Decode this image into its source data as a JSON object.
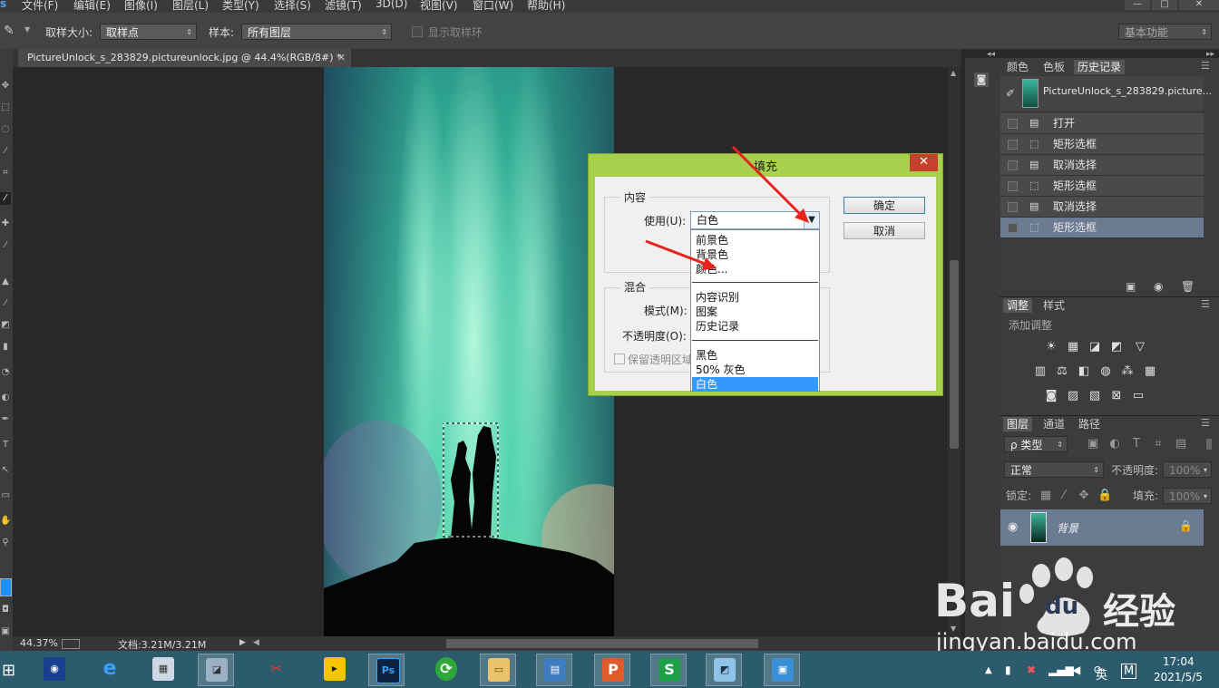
{
  "menubar": {
    "items": [
      "文件(F)",
      "编辑(E)",
      "图像(I)",
      "图层(L)",
      "类型(Y)",
      "选择(S)",
      "滤镜(T)",
      "3D(D)",
      "视图(V)",
      "窗口(W)",
      "帮助(H)"
    ]
  },
  "options": {
    "sample_size_label": "取样大小:",
    "sample_size_value": "取样点",
    "sample_label": "样本:",
    "sample_value": "所有图层",
    "show_ring_label": "显示取样环",
    "workspace": "基本功能"
  },
  "document": {
    "tab_title": "PictureUnlock_s_283829.pictureunlock.jpg @ 44.4%(RGB/8#) *",
    "zoom": "44.37%",
    "doc_size": "文档:3.21M/3.21M"
  },
  "history_panel": {
    "tabs": [
      "颜色",
      "色板",
      "历史记录"
    ],
    "snapshot": "PictureUnlock_s_283829.picture...",
    "items": [
      {
        "label": "打开",
        "icon": "document-icon",
        "selected": false
      },
      {
        "label": "矩形选框",
        "icon": "marquee-icon",
        "selected": false
      },
      {
        "label": "取消选择",
        "icon": "document-icon",
        "selected": false
      },
      {
        "label": "矩形选框",
        "icon": "marquee-icon",
        "selected": false
      },
      {
        "label": "取消选择",
        "icon": "document-icon",
        "selected": false
      },
      {
        "label": "矩形选框",
        "icon": "marquee-icon",
        "selected": true
      }
    ]
  },
  "adjust_panel": {
    "tabs": [
      "调整",
      "样式"
    ],
    "add_label": "添加调整"
  },
  "layers_panel": {
    "tabs": [
      "图层",
      "通道",
      "路径"
    ],
    "filter_label": "ρ 类型",
    "blend_mode": "正常",
    "opacity_label": "不透明度:",
    "opacity_value": "100%",
    "lock_label": "锁定:",
    "fill_label": "填充:",
    "fill_value": "100%",
    "layer_name": "背景"
  },
  "fill_dialog": {
    "title": "填充",
    "close": "✕",
    "content_group": "内容",
    "use_label": "使用(U):",
    "use_value": "白色",
    "blend_group": "混合",
    "mode_label": "模式(M):",
    "opacity_label": "不透明度(O):",
    "preserve_label": "保留透明区域",
    "ok": "确定",
    "cancel": "取消",
    "options": [
      "前景色",
      "背景色",
      "颜色...",
      "内容识别",
      "图案",
      "历史记录",
      "黑色",
      "50% 灰色",
      "白色"
    ],
    "selected_option": "白色"
  },
  "taskbar": {
    "time": "17:04",
    "date": "2021/5/5",
    "ime": "英",
    "ime2": "M"
  },
  "watermark": {
    "brand": "Bai",
    "brand2": "经验",
    "url": "jingyan.baidu.com"
  }
}
